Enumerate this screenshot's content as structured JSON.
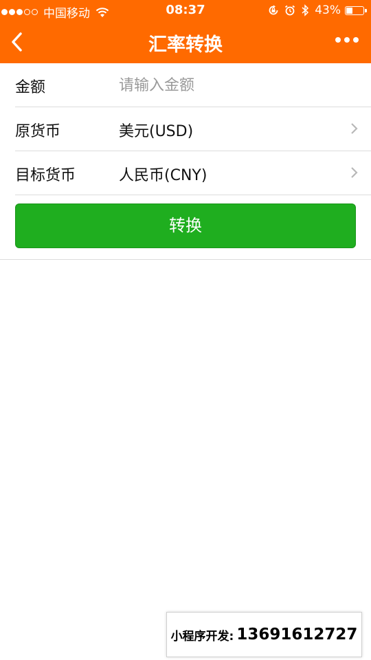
{
  "status_bar": {
    "signal": "●●●○○",
    "carrier": "中国移动",
    "time": "08:37",
    "battery_percent": "43%",
    "battery_level": 0.43,
    "icons": [
      "wifi-icon",
      "rotation-lock-icon",
      "alarm-icon",
      "bluetooth-icon",
      "battery-icon"
    ]
  },
  "navbar": {
    "title": "汇率转换",
    "back_icon": "chevron-left-icon",
    "more_icon": "more-dots-icon"
  },
  "form": {
    "amount": {
      "label": "金额",
      "value": "",
      "placeholder": "请输入金额"
    },
    "source_currency": {
      "label": "原货币",
      "value": "美元(USD)"
    },
    "target_currency": {
      "label": "目标货币",
      "value": "人民币(CNY)"
    }
  },
  "convert_button": {
    "label": "转换"
  },
  "promo": {
    "label": "小程序开发:",
    "phone": "13691612727"
  },
  "colors": {
    "header": "#ff6a00",
    "button": "#1fae1f",
    "divider": "#dcdcdc"
  }
}
